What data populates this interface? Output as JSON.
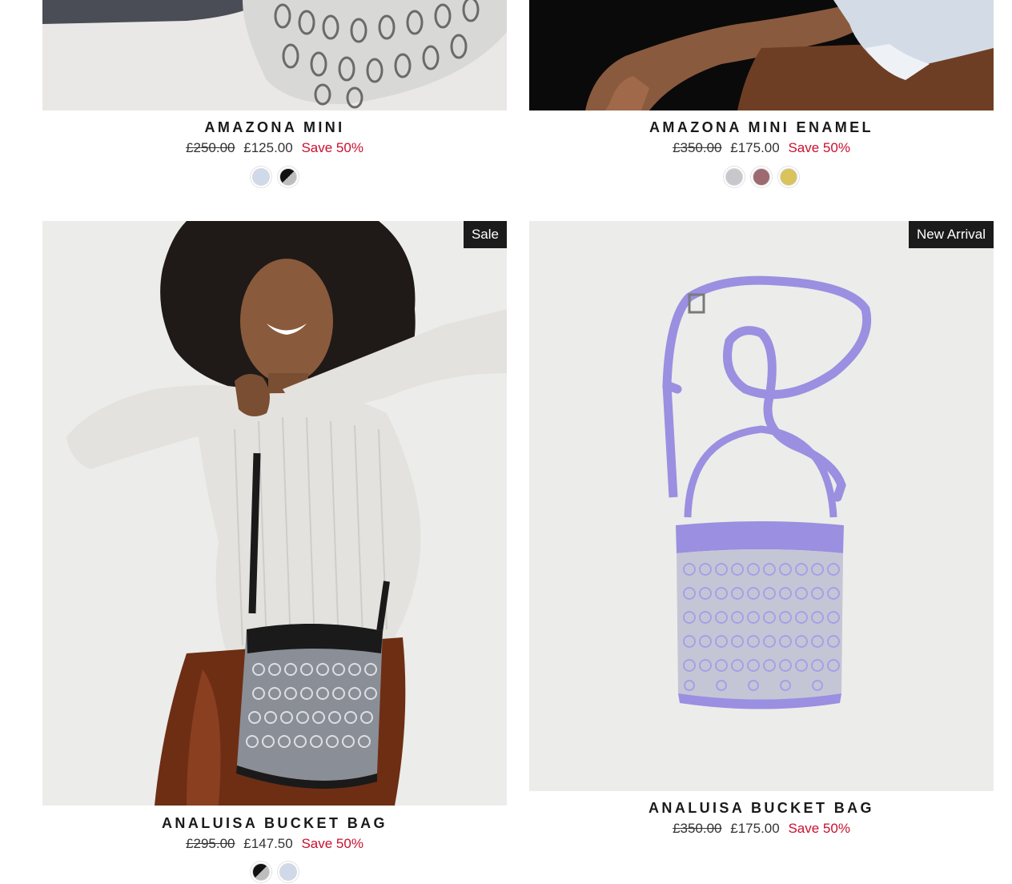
{
  "products": [
    {
      "title": "AMAZONA MINI",
      "old_price": "£250.00",
      "price": "£125.00",
      "save": "Save 50%",
      "swatches": [
        {
          "name": "light-blue",
          "color": "#cfd9ea"
        },
        {
          "name": "black-silver",
          "color": "split"
        }
      ]
    },
    {
      "title": "AMAZONA MINI ENAMEL",
      "old_price": "£350.00",
      "price": "£175.00",
      "save": "Save 50%",
      "swatches": [
        {
          "name": "silver",
          "color": "#c8c8cc"
        },
        {
          "name": "mauve",
          "color": "#9c6a70"
        },
        {
          "name": "gold",
          "color": "#d9c35a"
        }
      ]
    },
    {
      "badge": "Sale",
      "title": "ANALUISA BUCKET BAG",
      "old_price": "£295.00",
      "price": "£147.50",
      "save": "Save 50%",
      "swatches": [
        {
          "name": "black-silver",
          "color": "split"
        },
        {
          "name": "light-blue",
          "color": "#cfd9ea"
        }
      ]
    },
    {
      "badge": "New Arrival",
      "title": "ANALUISA BUCKET BAG",
      "old_price": "£350.00",
      "price": "£175.00",
      "save": "Save 50%"
    }
  ],
  "colors": {
    "sale_red": "#c8102e",
    "badge_bg": "#1b1b1b",
    "lavender": "#9a8fe0"
  }
}
